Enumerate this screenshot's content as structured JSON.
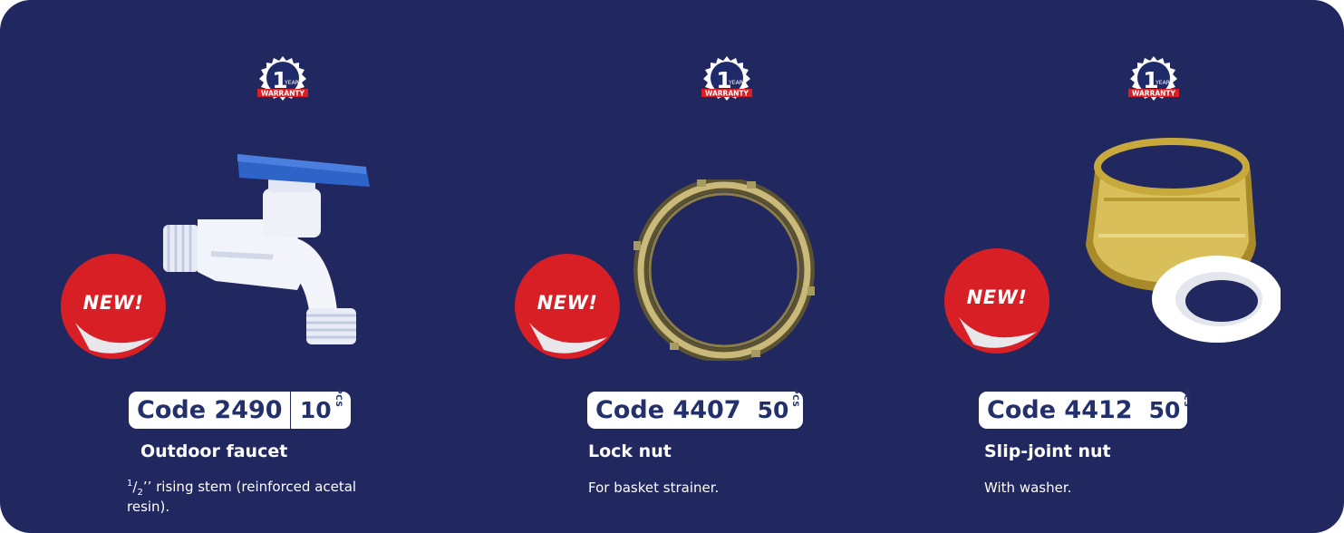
{
  "warranty_badge": {
    "number": "1",
    "year": "YEAR",
    "label": "WARRANTY"
  },
  "new_sticker": {
    "label": "NEW!"
  },
  "products": [
    {
      "code": "Code 2490",
      "quantity": "10",
      "unit": "PCS",
      "name": "Outdoor faucet",
      "description_fraction_top": "1",
      "description_fraction_bottom": "2",
      "description_rest": "’’ rising stem (reinforced acetal resin).",
      "icon": "outdoor-faucet"
    },
    {
      "code": "Code 4407",
      "quantity": "50",
      "unit": "PCS",
      "name": "Lock nut",
      "description": "For basket strainer.",
      "icon": "lock-nut"
    },
    {
      "code": "Code 4412",
      "quantity": "50",
      "unit": "PCS",
      "name": "Slip-joint nut",
      "description": "With washer.",
      "icon": "slip-joint-nut"
    }
  ],
  "colors": {
    "background": "#21275f",
    "accent_red": "#d81f26",
    "code_text": "#23306b",
    "faucet_handle": "#2e63c8"
  }
}
